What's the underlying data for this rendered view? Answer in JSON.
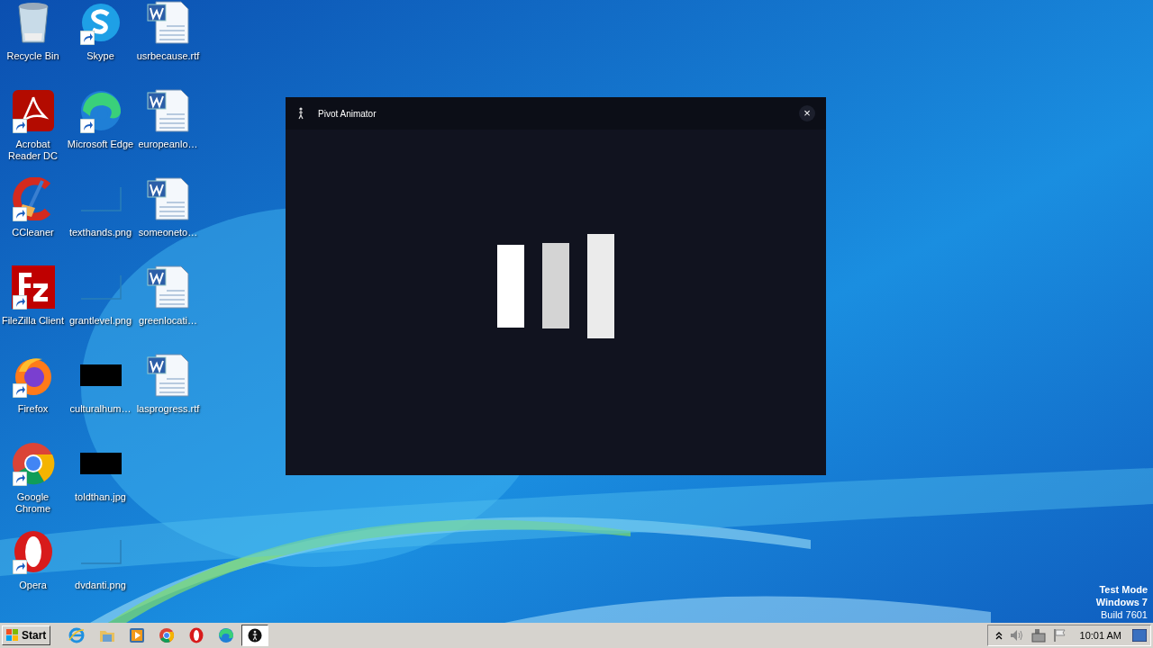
{
  "desktop_icons": [
    {
      "label": "Recycle Bin",
      "kind": "recycle",
      "shortcut": false
    },
    {
      "label": "Acrobat\nReader DC",
      "kind": "acrobat",
      "shortcut": true
    },
    {
      "label": "CCleaner",
      "kind": "ccleaner",
      "shortcut": true
    },
    {
      "label": "FileZilla Client",
      "kind": "filezilla",
      "shortcut": true
    },
    {
      "label": "Firefox",
      "kind": "firefox",
      "shortcut": true
    },
    {
      "label": "Google\nChrome",
      "kind": "chrome",
      "shortcut": true
    },
    {
      "label": "Opera",
      "kind": "opera",
      "shortcut": true
    },
    {
      "label": "Skype",
      "kind": "skype",
      "shortcut": true
    },
    {
      "label": "Microsoft Edge",
      "kind": "edge",
      "shortcut": true
    },
    {
      "label": "texthands.png",
      "kind": "blank",
      "shortcut": false
    },
    {
      "label": "grantlevel.png",
      "kind": "blank",
      "shortcut": false
    },
    {
      "label": "culturalhum…",
      "kind": "dark",
      "shortcut": false
    },
    {
      "label": "toldthan.jpg",
      "kind": "dark",
      "shortcut": false
    },
    {
      "label": "dvdanti.png",
      "kind": "blank",
      "shortcut": false
    },
    {
      "label": "usrbecause.rtf",
      "kind": "document",
      "shortcut": false
    },
    {
      "label": "europeanlo…",
      "kind": "document",
      "shortcut": false
    },
    {
      "label": "someoneto…",
      "kind": "document",
      "shortcut": false
    },
    {
      "label": "greenlocati…",
      "kind": "document",
      "shortcut": false
    },
    {
      "label": "lasprogress.rtf",
      "kind": "document",
      "shortcut": false
    }
  ],
  "window": {
    "title": "Pivot Animator",
    "close": "×"
  },
  "system_notice": [
    "Test Mode",
    "Windows 7",
    "Build 7601"
  ],
  "taskbar": {
    "start": "Start",
    "quick_launch": [
      {
        "kind": "ie"
      },
      {
        "kind": "folder"
      },
      {
        "kind": "media"
      },
      {
        "kind": "chrome"
      },
      {
        "kind": "opera"
      },
      {
        "kind": "edge"
      }
    ],
    "task": {
      "kind": "pivot",
      "selected": true
    },
    "time": "10:01 AM"
  }
}
